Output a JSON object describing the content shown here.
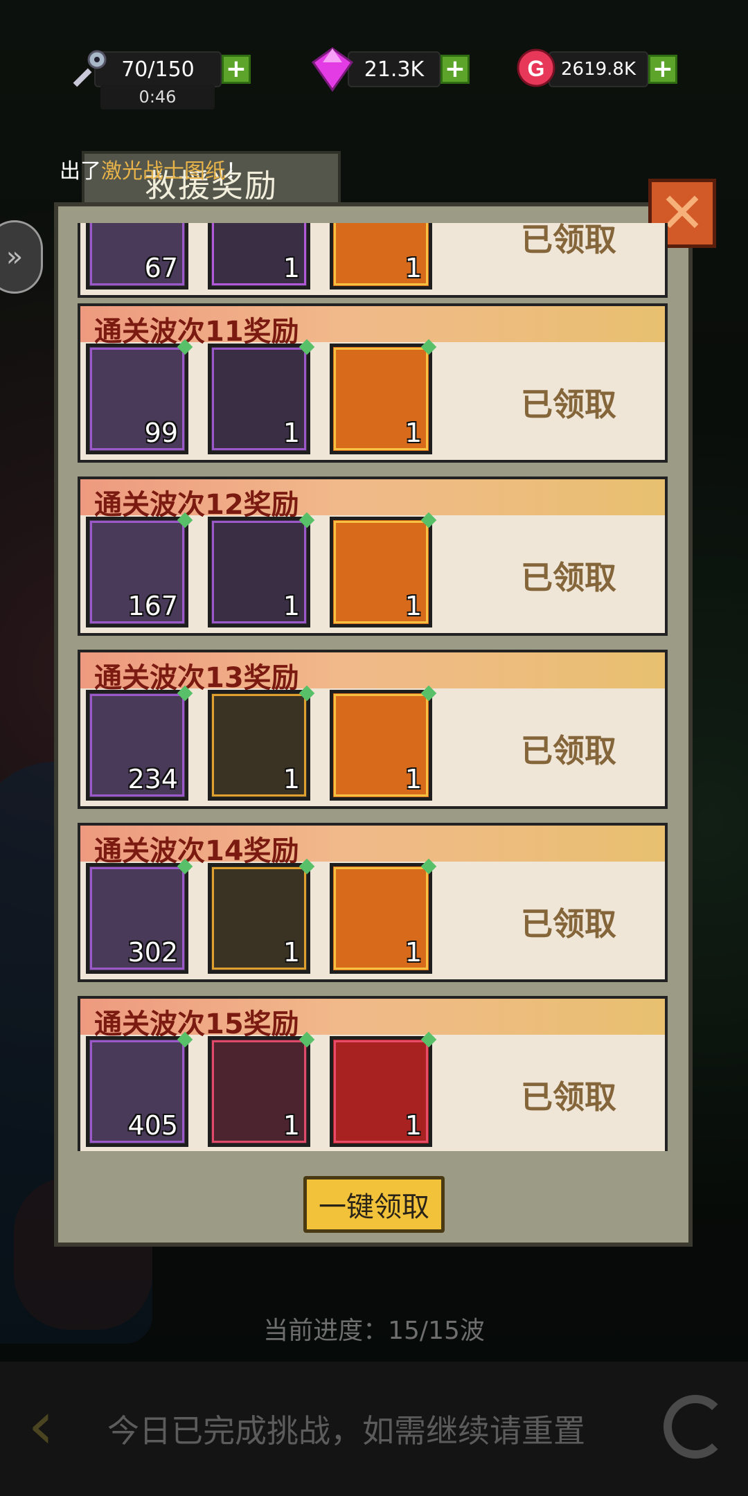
{
  "status": {
    "energy": {
      "icon": "key-wrench-icon",
      "value": "70/150",
      "timer": "0:46"
    },
    "gems": {
      "icon": "gem-icon",
      "value": "21.3K"
    },
    "gold": {
      "icon": "gold-coin-icon",
      "value": "2619.8K"
    }
  },
  "notice": {
    "prefix": "出了",
    "highlight": "激光战士图纸",
    "suffix": "！"
  },
  "modal": {
    "title": "救援奖励",
    "claim_all": "一键领取",
    "cards": [
      {
        "title": "",
        "claimed": "已领取",
        "items": [
          {
            "icon": "chest-icon",
            "qty": "67"
          },
          {
            "icon": "staff-icon",
            "qty": "1"
          },
          {
            "icon": "mystery-icon",
            "qty": "1"
          }
        ]
      },
      {
        "title": "通关波次11奖励",
        "claimed": "已领取",
        "items": [
          {
            "icon": "chest-icon",
            "qty": "99"
          },
          {
            "icon": "staff-icon",
            "qty": "1"
          },
          {
            "icon": "mystery-icon",
            "qty": "1"
          }
        ]
      },
      {
        "title": "通关波次12奖励",
        "claimed": "已领取",
        "items": [
          {
            "icon": "chest-icon",
            "qty": "167"
          },
          {
            "icon": "staff-icon",
            "qty": "1"
          },
          {
            "icon": "mystery-icon",
            "qty": "1"
          }
        ]
      },
      {
        "title": "通关波次13奖励",
        "claimed": "已领取",
        "items": [
          {
            "icon": "chest-icon",
            "qty": "234"
          },
          {
            "icon": "screwdriver-icon",
            "qty": "1"
          },
          {
            "icon": "mystery-icon",
            "qty": "1"
          }
        ]
      },
      {
        "title": "通关波次14奖励",
        "claimed": "已领取",
        "items": [
          {
            "icon": "chest-icon",
            "qty": "302"
          },
          {
            "icon": "screwdriver-icon",
            "qty": "1"
          },
          {
            "icon": "mystery-icon",
            "qty": "1"
          }
        ]
      },
      {
        "title": "通关波次15奖励",
        "claimed": "已领取",
        "items": [
          {
            "icon": "chest-icon",
            "qty": "405"
          },
          {
            "icon": "screwdriver-icon",
            "qty": "1"
          },
          {
            "icon": "mystery-icon",
            "qty": "1"
          }
        ]
      }
    ]
  },
  "progress": "当前进度：15/15波",
  "bottom": {
    "message": "今日已完成挑战，如需继续请重置"
  },
  "colors": {
    "accent_gold": "#f2c23a",
    "claimed_text": "#84663a",
    "card_bg": "#f0e6d8"
  }
}
